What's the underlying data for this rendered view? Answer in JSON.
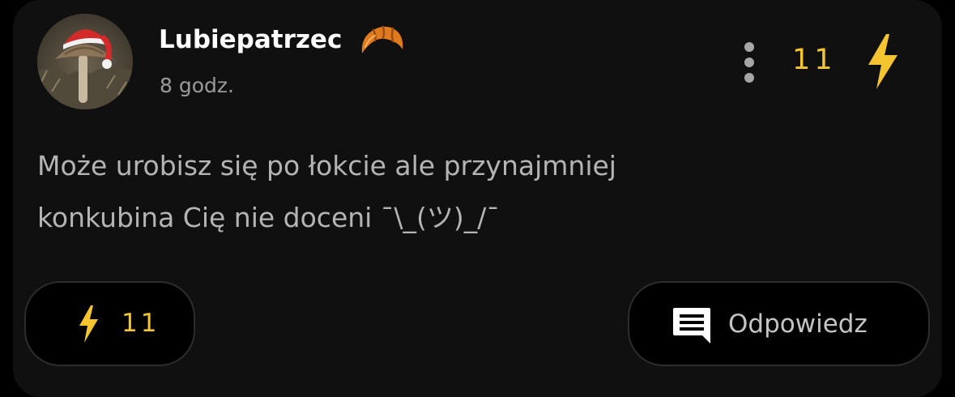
{
  "post": {
    "author": "Lubiepatrzec",
    "time": "8 godz.",
    "votes": "11",
    "text": "Może urobisz się po łokcie ale przynajmniej\nkonkubina Cię nie doceni ¯\\_(ツ)_/¯"
  },
  "actions": {
    "plus_count": "11",
    "reply_label": "Odpowiedz"
  },
  "icons": {
    "author_badge": "croissant-icon",
    "more": "more-vertical-icon",
    "vote": "lightning-bolt-icon",
    "reply": "comment-icon"
  },
  "colors": {
    "card_background": "#101010",
    "accent_yellow": "#f5c531",
    "text_primary": "#ffffff",
    "text_secondary": "#b4b4b4",
    "pill_border": "#2d2d2d"
  }
}
